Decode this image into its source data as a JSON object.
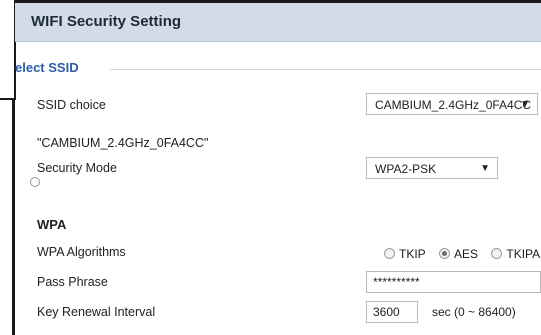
{
  "header": {
    "title": "WIFI Security Setting"
  },
  "select_ssid": {
    "legend": "elect SSID",
    "ssid_choice_label": "SSID choice",
    "ssid_choice_value": "CAMBIUM_2.4GHz_0FA4CC",
    "ssid_name": "\"CAMBIUM_2.4GHz_0FA4CC\"",
    "security_mode_label": "Security Mode",
    "security_mode_value": "WPA2-PSK"
  },
  "wpa": {
    "title": "WPA",
    "algorithms_label": "WPA Algorithms",
    "algorithms": [
      {
        "label": "TKIP",
        "checked": false
      },
      {
        "label": "AES",
        "checked": true
      },
      {
        "label": "TKIPAES",
        "checked": false
      }
    ],
    "pass_phrase_label": "Pass Phrase",
    "pass_phrase_value": "**********",
    "key_renewal_label": "Key Renewal Interval",
    "key_renewal_value": "3600",
    "key_renewal_unit": "sec  (0 ~ 86400)"
  },
  "icons": {
    "dropdown": "triangle-down-icon"
  }
}
